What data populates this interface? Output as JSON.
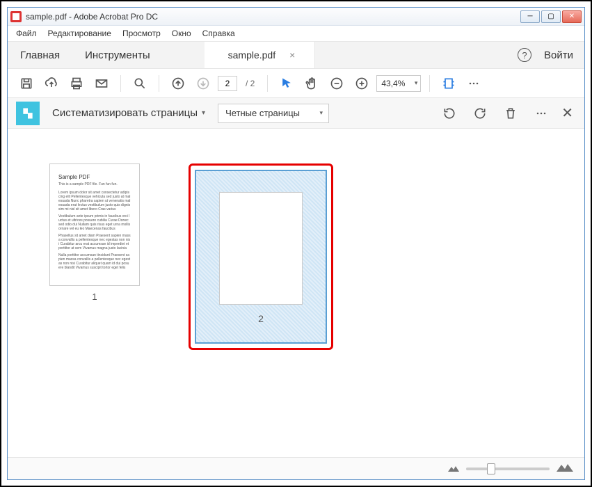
{
  "window": {
    "title": "sample.pdf - Adobe Acrobat Pro DC"
  },
  "menu": {
    "file": "Файл",
    "edit": "Редактирование",
    "view": "Просмотр",
    "window": "Окно",
    "help": "Справка"
  },
  "tabs": {
    "home": "Главная",
    "tools": "Инструменты",
    "doc": "sample.pdf",
    "signin": "Войти"
  },
  "toolbar": {
    "current_page": "2",
    "total_pages": "2",
    "zoom": "43,4%"
  },
  "panel": {
    "title": "Систематизировать страницы",
    "filter": "Четные страницы"
  },
  "thumbs": {
    "page1": {
      "num": "1",
      "title": "Sample PDF",
      "sub": "This is a sample PDF file. Fun fun fun."
    },
    "page2": {
      "num": "2"
    }
  }
}
